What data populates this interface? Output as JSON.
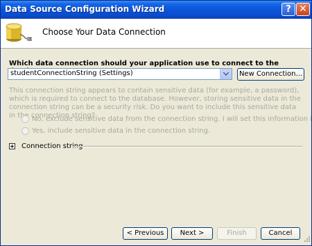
{
  "window": {
    "title": "Data Source Configuration Wizard",
    "help_label": "?",
    "close_label": "✕"
  },
  "header": {
    "title": "Choose Your Data Connection",
    "icon": "database-plug-icon"
  },
  "form": {
    "question": "Which data connection should your application use to connect to the database?",
    "connection_value": "studentConnectionString (Settings)",
    "new_connection_label": "New Connection...",
    "sensitive_description": "This connection string appears to contain sensitive data (for example, a password), which is required to connect to the database. However, storing sensitive data in the connection string can be a security risk. Do you want to include this sensitive data in the connection string?",
    "option_exclude": "No, exclude sensitive data from the connection string. I will set this information in my application code.",
    "option_include": "Yes, include sensitive data in the connection string.",
    "connection_string_label": "Connection string"
  },
  "buttons": {
    "previous": "< Previous",
    "next": "Next >",
    "finish": "Finish",
    "cancel": "Cancel"
  },
  "colors": {
    "title_bar": "#0c55d9",
    "dialog_bg": "#ece9d8",
    "disabled_text": "#a9a89e"
  }
}
